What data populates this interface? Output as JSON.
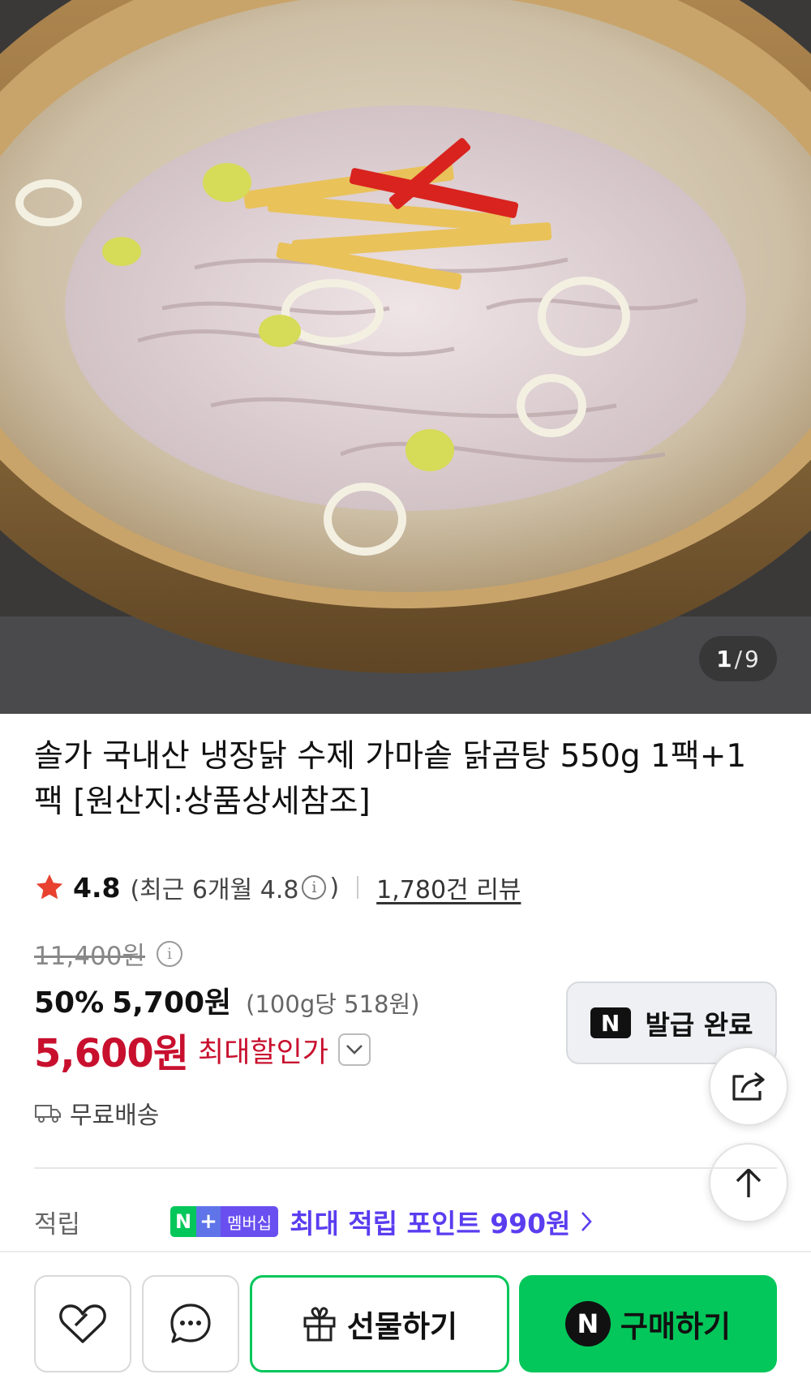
{
  "gallery": {
    "current": "1",
    "separator": "/",
    "total": "9"
  },
  "product": {
    "title": "솔가 국내산 냉장닭 수제 가마솥 닭곰탕 550g 1팩+1팩 [원산지:상품상세참조]",
    "rating": "4.8",
    "rating_recent_prefix": "(최근 6개월 4.8",
    "rating_recent_suffix": ")",
    "info_glyph": "i",
    "review_count": "1,780건 리뷰",
    "original_price": "11,400원",
    "discount_rate": "50%",
    "sale_price": "5,700원",
    "unit_price": "(100g당 518원)",
    "max_discount_price": "5,600원",
    "max_discount_label": "최대할인가",
    "shipping": "무료배송"
  },
  "coupon": {
    "badge": "N",
    "label": "발급 완료"
  },
  "points": {
    "label": "적립",
    "badge_n": "N",
    "badge_plus": "+",
    "badge_text": "멤버십",
    "text": "최대 적립 포인트 990원"
  },
  "bottom_bar": {
    "gift_label": "선물하기",
    "buy_badge": "N",
    "buy_label": "구매하기"
  },
  "colors": {
    "naver_green": "#03c75a",
    "discount_red": "#c8102e",
    "membership_purple": "#5b3df0",
    "star": "#e8412f"
  },
  "icons": [
    "share-icon",
    "arrow-up-icon",
    "heart-icon",
    "chat-icon",
    "gift-icon",
    "truck-icon",
    "star-icon",
    "chevron-down-icon",
    "chevron-right-icon"
  ]
}
